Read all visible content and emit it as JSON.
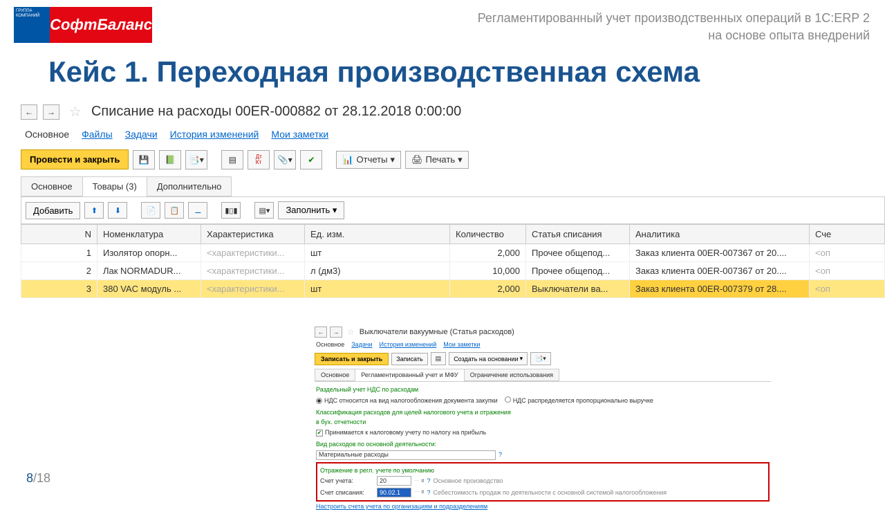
{
  "logo": {
    "small": "ГРУППА КОМПАНИЙ",
    "main": "СофтБаланс"
  },
  "subtitle": {
    "line1": "Регламентированный учет производственных операций в 1С:ERP 2",
    "line2": "на основе опыта внедрений"
  },
  "case_title": "Кейс 1. Переходная производственная схема",
  "main": {
    "doc_title": "Списание на расходы 00ER-000882 от 28.12.2018 0:00:00",
    "tabs": [
      "Основное",
      "Файлы",
      "Задачи",
      "История изменений",
      "Мои заметки"
    ],
    "toolbar": {
      "post_close": "Провести и закрыть",
      "reports": "Отчеты",
      "print": "Печать"
    },
    "doc_tabs": [
      "Основное",
      "Товары (3)",
      "Дополнительно"
    ],
    "table_toolbar": {
      "add": "Добавить",
      "fill": "Заполнить"
    },
    "columns": [
      "N",
      "Номенклатура",
      "Характеристика",
      "Ед. изм.",
      "Количество",
      "Статья списания",
      "Аналитика",
      "Сче"
    ],
    "rows": [
      {
        "n": "1",
        "nom": "Изолятор опорн...",
        "char": "<характеристики...",
        "unit": "шт",
        "qty": "2,000",
        "article": "Прочее общепод...",
        "analytics": "Заказ клиента 00ER-007367 от 20....",
        "acc": "<оп"
      },
      {
        "n": "2",
        "nom": "Лак NORMADUR...",
        "char": "<характеристики...",
        "unit": "л (дм3)",
        "qty": "10,000",
        "article": "Прочее общепод...",
        "analytics": "Заказ клиента 00ER-007367 от 20....",
        "acc": "<оп"
      },
      {
        "n": "3",
        "nom": "380 VAC модуль ...",
        "char": "<характеристики...",
        "unit": "шт",
        "qty": "2,000",
        "article": "Выключатели ва...",
        "analytics": "Заказ клиента 00ER-007379 от 28....",
        "acc": "<оп"
      }
    ]
  },
  "sub": {
    "title": "Выключатели вакуумные (Статья расходов)",
    "tabs": [
      "Основное",
      "Задачи",
      "История изменений",
      "Мои заметки"
    ],
    "toolbar": {
      "save_close": "Записать и закрыть",
      "save": "Записать",
      "create_on": "Создать на основании"
    },
    "doc_tabs": [
      "Основное",
      "Регламентированный учет и МФУ",
      "Ограничение использования"
    ],
    "h1": "Раздельный учет НДС по расходам",
    "r1": "НДС относится на вид налогообложения документа закупки",
    "r2": "НДС распределяется пропорционально выручке",
    "h2_a": "Классификация расходов для целей налогового учета и отражения",
    "h2_b": "в бух. отчетности",
    "chk": "Принимается к налоговому учету по налогу на прибыль",
    "h3": "Вид расходов по основной деятельности:",
    "field3": "Материальные расходы",
    "h4": "Отражение в регл. учете по умолчанию",
    "acct_label": "Счет учета:",
    "acct_val": "20",
    "acct_desc": "Основное производство",
    "wo_label": "Счет списания:",
    "wo_val": "90.02.1",
    "wo_desc": "Себестоимость продаж по деятельности с основной системой налогообложения",
    "link": "Настроить счета учета по организациям и подразделениям"
  },
  "page": {
    "cur": "8",
    "sep": "/",
    "tot": "18"
  }
}
